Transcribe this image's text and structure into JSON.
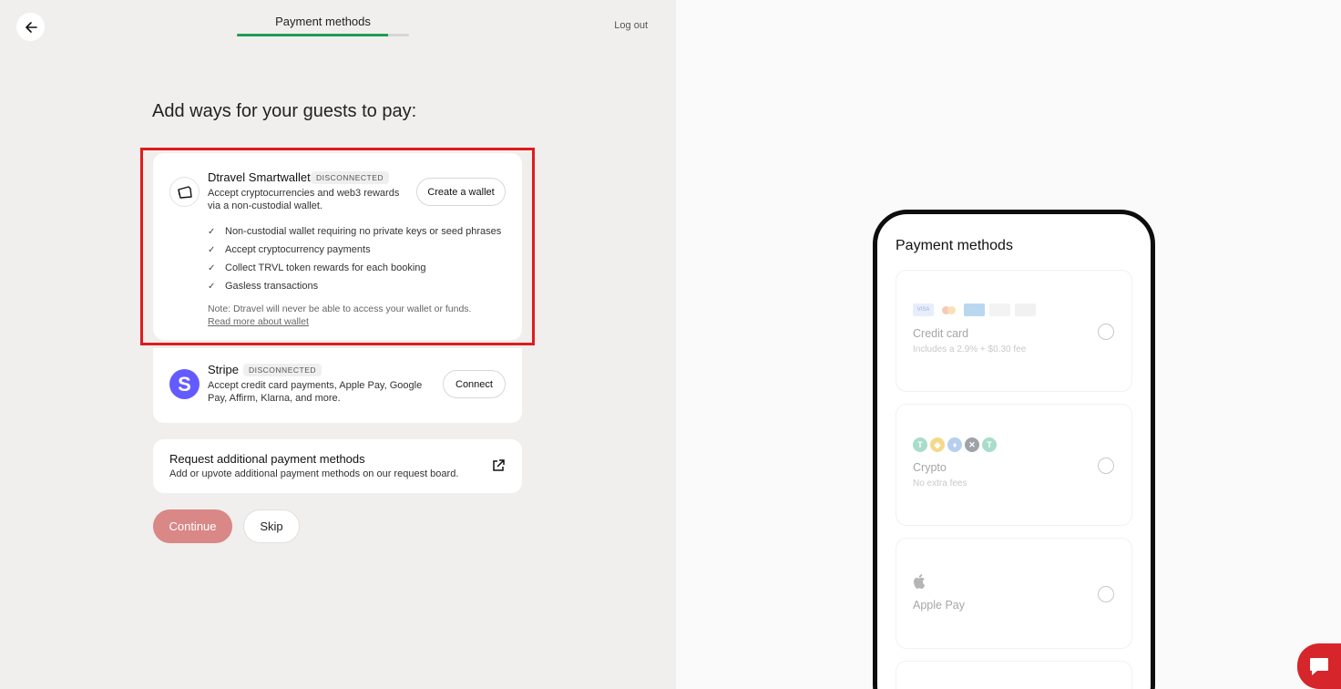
{
  "header": {
    "step_title": "Payment methods",
    "progress_percent": 88,
    "logout_label": "Log out"
  },
  "heading": "Add ways for your guests to pay:",
  "wallet": {
    "title": "Dtravel Smartwallet",
    "badge": "DISCONNECTED",
    "description": "Accept cryptocurrencies and web3 rewards via a non-custodial wallet.",
    "button_label": "Create a wallet",
    "features": [
      "Non-custodial wallet requiring no private keys or seed phrases",
      "Accept cryptocurrency payments",
      "Collect TRVL token rewards for each booking",
      "Gasless transactions"
    ],
    "note": "Note: Dtravel will never be able to access your wallet or funds.",
    "note_link": "Read more about wallet",
    "icon": "wallet-icon"
  },
  "stripe": {
    "title": "Stripe",
    "badge": "DISCONNECTED",
    "description": "Accept credit card payments, Apple Pay, Google Pay, Affirm, Klarna, and more.",
    "button_label": "Connect",
    "logo_letter": "S",
    "brand_color": "#635bff"
  },
  "request": {
    "title": "Request additional payment methods",
    "description": "Add or upvote additional payment methods on our request board.",
    "icon": "external-link-icon"
  },
  "actions": {
    "continue_label": "Continue",
    "skip_label": "Skip",
    "continue_color": "#d98787"
  },
  "preview": {
    "title": "Payment methods",
    "methods": [
      {
        "label": "Credit card",
        "sub": "Includes a 2.9% + $0.30 fee",
        "icons": [
          "VISA",
          "mastercard",
          "AMEX",
          "JCB",
          "discover"
        ]
      },
      {
        "label": "Crypto",
        "sub": "No extra fees",
        "icons": [
          "tether-icon",
          "bnb-icon",
          "ethereum-icon",
          "trvl-icon",
          "tether-icon"
        ]
      },
      {
        "label": "Apple Pay",
        "sub": "",
        "icons": [
          "apple-icon"
        ]
      }
    ]
  },
  "colors": {
    "highlight": "#e01b1b",
    "progress": "#1f9d55",
    "chat": "#d6252b"
  }
}
